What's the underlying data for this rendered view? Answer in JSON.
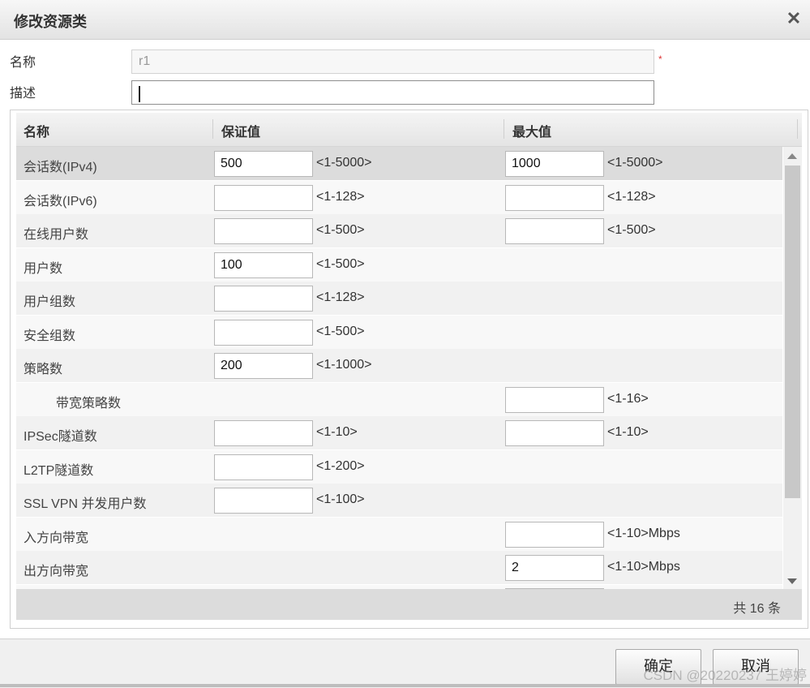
{
  "dialog": {
    "title": "修改资源类"
  },
  "form": {
    "name_label": "名称",
    "name_value": "r1",
    "required_mark": "*",
    "desc_label": "描述",
    "desc_value": ""
  },
  "grid": {
    "headers": [
      "名称",
      "保证值",
      "最大值"
    ],
    "rows": [
      {
        "name": "会话数(IPv4)",
        "guarantee": "500",
        "guarantee_range": "<1-5000>",
        "max": "1000",
        "max_range": "<1-5000>"
      },
      {
        "name": "会话数(IPv6)",
        "guarantee": "",
        "guarantee_range": "<1-128>",
        "max": "",
        "max_range": "<1-128>"
      },
      {
        "name": "在线用户数",
        "guarantee": "",
        "guarantee_range": "<1-500>",
        "max": "",
        "max_range": "<1-500>"
      },
      {
        "name": "用户数",
        "guarantee": "100",
        "guarantee_range": "<1-500>"
      },
      {
        "name": "用户组数",
        "guarantee": "",
        "guarantee_range": "<1-128>"
      },
      {
        "name": "安全组数",
        "guarantee": "",
        "guarantee_range": "<1-500>"
      },
      {
        "name": "策略数",
        "guarantee": "200",
        "guarantee_range": "<1-1000>"
      },
      {
        "name": "带宽策略数",
        "max": "",
        "max_range": "<1-16>"
      },
      {
        "name": "IPSec隧道数",
        "guarantee": "",
        "guarantee_range": "<1-10>",
        "max": "",
        "max_range": "<1-10>"
      },
      {
        "name": "L2TP隧道数",
        "guarantee": "",
        "guarantee_range": "<1-200>"
      },
      {
        "name": "SSL VPN 并发用户数",
        "guarantee": "",
        "guarantee_range": "<1-100>"
      },
      {
        "name": "入方向带宽",
        "max": "",
        "max_range": "<1-10>Mbps"
      },
      {
        "name": "出方向带宽",
        "max": "2",
        "max_range": "<1-10>Mbps"
      }
    ],
    "total": "共 16 条"
  },
  "footer": {
    "ok_label": "确定",
    "cancel_label": "取消",
    "watermark": "CSDN @20220237 王婷婷"
  }
}
